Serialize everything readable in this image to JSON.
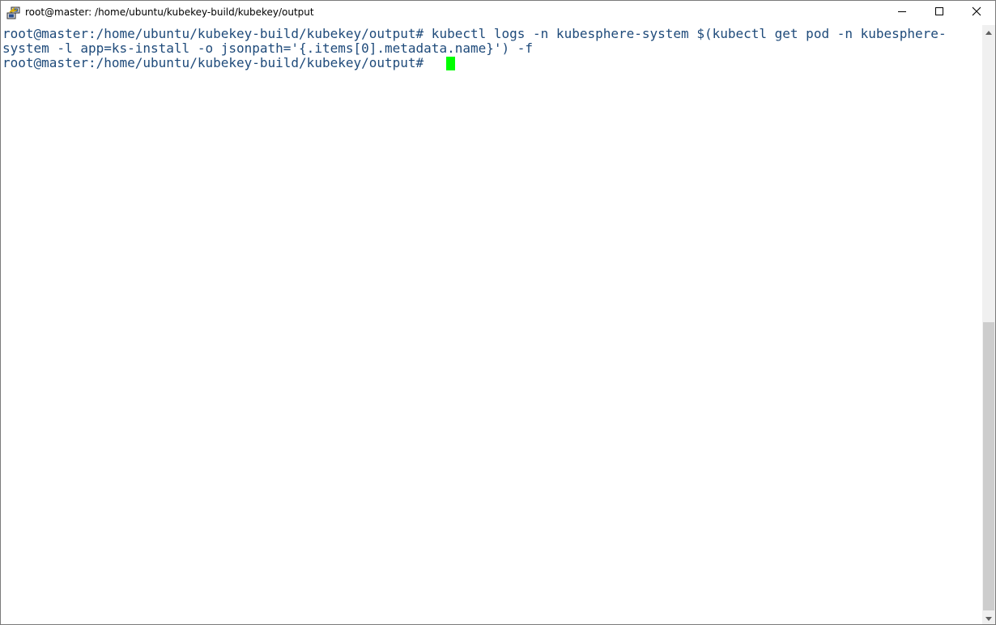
{
  "window": {
    "title": "root@master: /home/ubuntu/kubekey-build/kubekey/output",
    "icon": "putty-icon",
    "controls": {
      "minimize": "minimize-icon",
      "maximize": "maximize-icon",
      "close": "close-icon"
    }
  },
  "terminal": {
    "lines": [
      "root@master:/home/ubuntu/kubekey-build/kubekey/output# kubectl logs -n kubesphere-system $(kubectl get pod -n kubesphere-",
      "system -l app=ks-install -o jsonpath='{.items[0].metadata.name}') -f",
      "root@master:/home/ubuntu/kubekey-build/kubekey/output# "
    ],
    "colors": {
      "text": "#1e4a7a",
      "background": "#ffffff",
      "cursor": "#00ff00"
    }
  },
  "scrollbar": {
    "position": 0.5
  }
}
